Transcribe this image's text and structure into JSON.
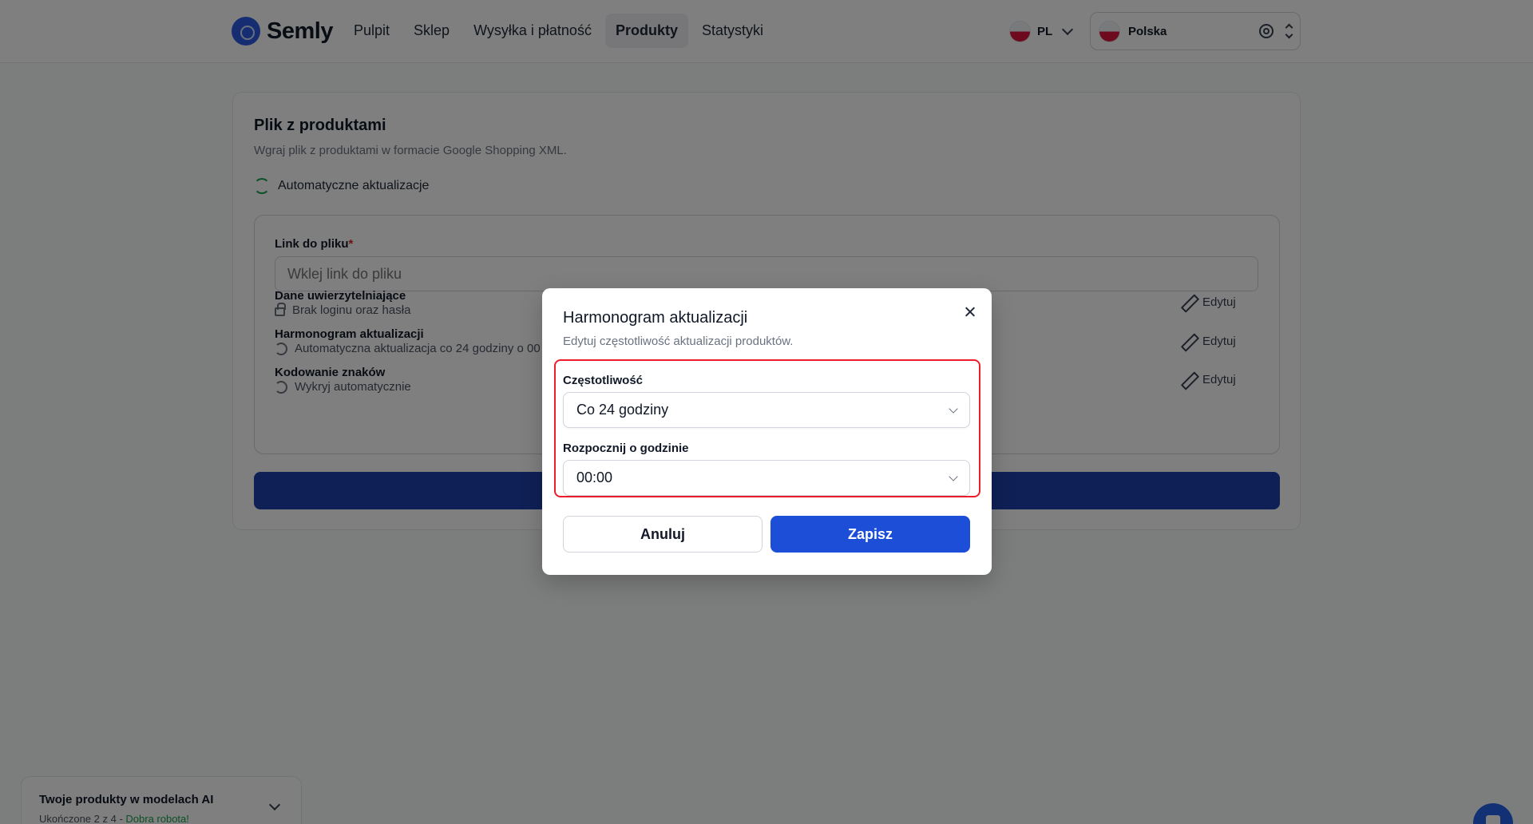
{
  "header": {
    "brand": "Semly",
    "nav": [
      "Pulpit",
      "Sklep",
      "Wysyłka i płatność",
      "Produkty",
      "Statystyki"
    ],
    "active_nav": "Produkty",
    "language": "PL",
    "country": "Polska"
  },
  "card": {
    "title": "Plik z produktami",
    "subtitle": "Wgraj plik z produktami w formacie Google Shopping XML.",
    "auto_updates_label": "Automatyczne aktualizacje",
    "link_label": "Link do pliku",
    "required_mark": "*",
    "link_placeholder": "Wklej link do pliku",
    "rows": [
      {
        "title": "Dane uwierzytelniające",
        "value": "Brak loginu oraz hasła",
        "action": "Edytuj"
      },
      {
        "title": "Harmonogram aktualizacji",
        "value": "Automatyczna aktualizacja co 24 godziny o 00",
        "action": "Edytuj"
      },
      {
        "title": "Kodowanie znaków",
        "value": "Wykryj automatycznie",
        "action": "Edytuj"
      }
    ]
  },
  "modal": {
    "title": "Harmonogram aktualizacji",
    "subtitle": "Edytuj częstotliwość aktualizacji produktów.",
    "frequency_label": "Częstotliwość",
    "frequency_value": "Co 24 godziny",
    "start_label": "Rozpocznij o godzinie",
    "start_value": "00:00",
    "cancel_label": "Anuluj",
    "save_label": "Zapisz"
  },
  "widget": {
    "title": "Twoje produkty w modelach AI",
    "progress_text": "Ukończone 2 z 4 - ",
    "progress_ok": "Dobra robota!"
  },
  "colors": {
    "primary": "#1d4ed8",
    "success": "#16a34a",
    "highlight": "#ef1c2a"
  }
}
